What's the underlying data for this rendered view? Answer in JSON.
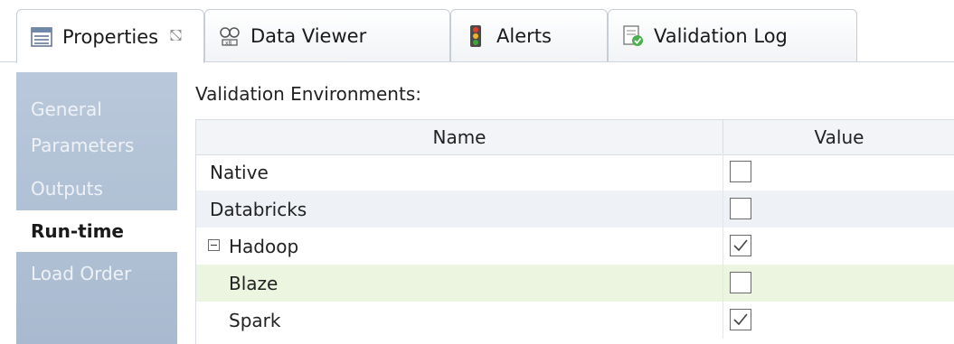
{
  "tabs": [
    {
      "label": "Properties",
      "icon": "properties-icon",
      "active": true,
      "closable": true
    },
    {
      "label": "Data Viewer",
      "icon": "data-viewer-icon",
      "active": false
    },
    {
      "label": "Alerts",
      "icon": "traffic-light-icon",
      "active": false
    },
    {
      "label": "Validation Log",
      "icon": "validation-log-icon",
      "active": false
    }
  ],
  "sidebar": {
    "items": [
      {
        "label": "General",
        "selected": false
      },
      {
        "label": "Parameters",
        "selected": false
      },
      {
        "label": "Outputs",
        "selected": false
      },
      {
        "label": "Run-time",
        "selected": true
      },
      {
        "label": "Load Order",
        "selected": false
      }
    ]
  },
  "main": {
    "section_title": "Validation Environments:",
    "columns": [
      "Name",
      "Value"
    ],
    "rows": [
      {
        "name": "Native",
        "checked": false,
        "level": 0,
        "expander": false
      },
      {
        "name": "Databricks",
        "checked": false,
        "level": 0,
        "expander": false
      },
      {
        "name": "Hadoop",
        "checked": true,
        "level": 0,
        "expander": true
      },
      {
        "name": "Blaze",
        "checked": false,
        "level": 1,
        "expander": false,
        "selected": true
      },
      {
        "name": "Spark",
        "checked": true,
        "level": 1,
        "expander": false
      }
    ]
  },
  "colors": {
    "sidebar_bg": "#b0c0d5",
    "selected_row": "#ecf5df",
    "alt_row": "#eef1f6"
  }
}
